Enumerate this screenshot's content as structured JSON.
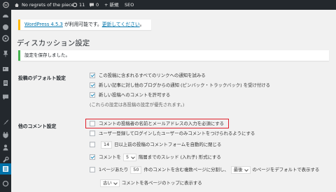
{
  "admin_bar": {
    "site_name": "No regrets of the piece",
    "updates_count": "11",
    "comments_count": "0",
    "new_label": "+ 新規",
    "seo_label": "SEO"
  },
  "notice": {
    "version_link": "WordPress 4.5.3",
    "available_text": " が利用可能です。",
    "update_link": "更新してください",
    "end": "。"
  },
  "page": {
    "title": "ディスカッション設定",
    "saved_message": "設定を保存しました。"
  },
  "default_post_settings": {
    "label": "投稿のデフォルト設定",
    "options": [
      {
        "label": "この投稿に含まれるすべてのリンクへの通知を試みる",
        "checked": true
      },
      {
        "label": "新しい記事に対し他のブログからの通知 (ピンバック・トラックバック) を受け付ける",
        "checked": true
      },
      {
        "label": "新しい投稿へのコメントを許可する",
        "checked": true
      }
    ],
    "note": "(これらの設定は各投稿の設定が優先されます。)"
  },
  "other_comment_settings": {
    "label": "他のコメント設定",
    "require_name_email": {
      "label": "コメントの投稿者の名前とメールアドレスの入力を必須にする",
      "checked": false
    },
    "registered_only": {
      "label": "ユーザー登録してログインしたユーザーのみコメントをつけられるようにする",
      "checked": false
    },
    "auto_close": {
      "days": "14",
      "label": "日以上前の投稿のコメントフォームを自動的に閉じる",
      "checked": false
    },
    "threaded": {
      "prefix": "コメントを",
      "depth": "5",
      "suffix": "階層までのスレッド (入れ子) 形式にする",
      "checked": true
    },
    "paginate": {
      "prefix": "1ページあたり",
      "count": "50",
      "middle": "件のコメントを含む複数ページに分割し、",
      "page_select": "最後",
      "suffix": "のページをデフォルトで表示する",
      "checked": false
    },
    "order": {
      "select": "古い",
      "suffix": "コメントを各ページのトップに表示する"
    }
  }
}
